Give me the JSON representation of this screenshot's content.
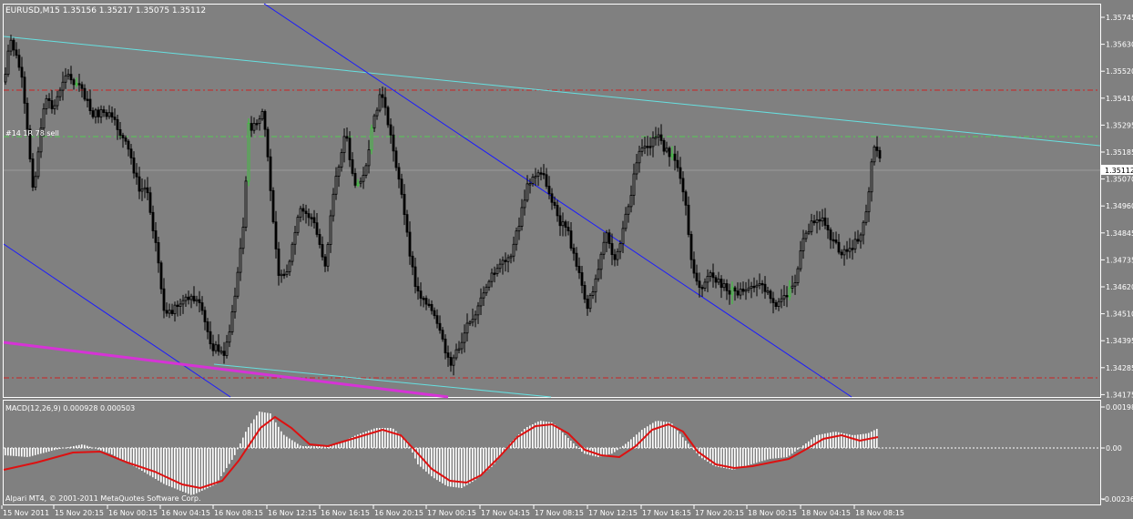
{
  "window": {
    "symbol_header": "EURUSD,M15  1.35156 1.35217 1.35075 1.35112"
  },
  "main_panel": {
    "price_axis_labels": [
      "1.35745",
      "1.35630",
      "1.35520",
      "1.35410",
      "1.35295",
      "1.35185",
      "1.35070",
      "1.34960",
      "1.34845",
      "1.34735",
      "1.34620",
      "1.34510",
      "1.34395",
      "1.34285",
      "1.34175"
    ],
    "current_price": "1.35112",
    "order_label": "#14  1R  78 sell",
    "colors": {
      "background": "#808080",
      "candle": "#000000",
      "bull_candle": "#33cc33",
      "trendline_cyan": "#66e0e0",
      "trendline_blue": "#1a1aff",
      "trendline_magenta": "#d633d6",
      "level_red": "#cc2222",
      "level_green": "#55cc55"
    }
  },
  "macd_panel": {
    "label": "MACD(12,26,9) 0.000928 0.000503",
    "axis_labels": [
      "0.00198",
      "0.00",
      "-0.00236"
    ]
  },
  "footer": {
    "copyright": "Alpari MT4, © 2001-2011 MetaQuotes Software Corp."
  },
  "time_axis": {
    "labels": [
      "15 Nov 2011",
      "15 Nov 20:15",
      "16 Nov 00:15",
      "16 Nov 04:15",
      "16 Nov 08:15",
      "16 Nov 12:15",
      "16 Nov 16:15",
      "16 Nov 20:15",
      "17 Nov 00:15",
      "17 Nov 04:15",
      "17 Nov 08:15",
      "17 Nov 12:15",
      "17 Nov 16:15",
      "17 Nov 20:15",
      "18 Nov 00:15",
      "18 Nov 04:15",
      "18 Nov 08:15"
    ]
  }
}
